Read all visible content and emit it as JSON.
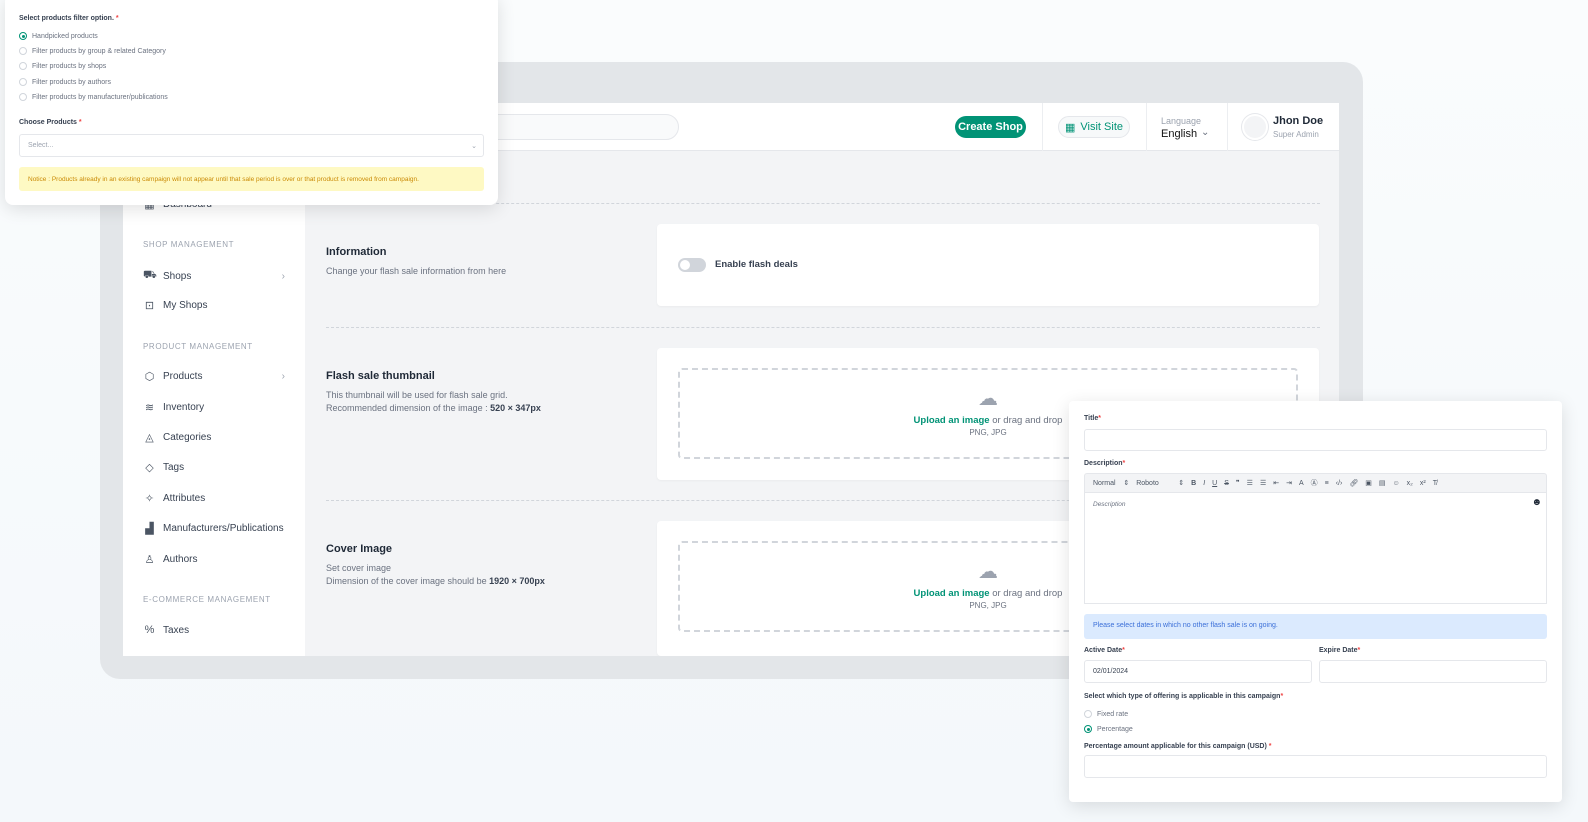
{
  "header": {
    "create_shop": "Create Shop",
    "visit_site": "Visit Site",
    "language_label": "Language",
    "language_value": "English",
    "user_name": "Jhon Doe",
    "user_role": "Super Admin"
  },
  "sidebar": {
    "dashboard": "Dashboard",
    "shop_management": "SHOP MANAGEMENT",
    "shops": "Shops",
    "my_shops": "My Shops",
    "product_management": "PRODUCT MANAGEMENT",
    "products": "Products",
    "inventory": "Inventory",
    "categories": "Categories",
    "tags": "Tags",
    "attributes": "Attributes",
    "manufacturers": "Manufacturers/Publications",
    "authors": "Authors",
    "ecommerce_management": "E-COMMERCE MANAGEMENT",
    "taxes": "Taxes"
  },
  "main": {
    "info_title": "Information",
    "info_desc": "Change your flash sale information from here",
    "enable_flash": "Enable flash deals",
    "enable_flash_on": false,
    "thumb_title": "Flash sale thumbnail",
    "thumb_desc": "This thumbnail will be used for flash sale grid.",
    "thumb_dim_label": "Recommended dimension of the image :",
    "thumb_dim": "520 × 347px",
    "cover_title": "Cover Image",
    "cover_desc": "Set cover image",
    "cover_dim_label": "Dimension of the cover image should be",
    "cover_dim": "1920 × 700px",
    "upload_link": "Upload an image",
    "upload_rest": " or drag and drop",
    "formats": "PNG, JPG"
  },
  "filter_popup": {
    "label": "Select products filter option.",
    "options": [
      "Handpicked products",
      "Filter products by group & related Category",
      "Filter products by shops",
      "Filter products by authors",
      "Filter products by manufacturer/publications"
    ],
    "selected": "Handpicked products",
    "choose_label": "Choose Products",
    "choose_placeholder": "Select...",
    "notice": "Notice : Products already in an existing campaign will not appear until that sale period is over or that product is removed from campaign."
  },
  "form_popup": {
    "title_label": "Title",
    "description_label": "Description",
    "toolbar_heading": "Normal",
    "toolbar_font": "Roboto",
    "description_placeholder": "Description",
    "date_notice": "Please select dates in which no other flash sale is on going.",
    "active_date_label": "Active Date",
    "active_date_value": "02/01/2024",
    "expire_date_label": "Expire Date",
    "offering_label": "Select which type of offering is applicable in this campaign",
    "offering_options": [
      "Fixed rate",
      "Percentage"
    ],
    "offering_selected": "Percentage",
    "amount_label": "Percentage amount applicable for this campaign (USD)"
  },
  "colors": {
    "accent": "#019376",
    "notice_bg": "#fef9c3",
    "info_bg": "#dbeafe"
  }
}
